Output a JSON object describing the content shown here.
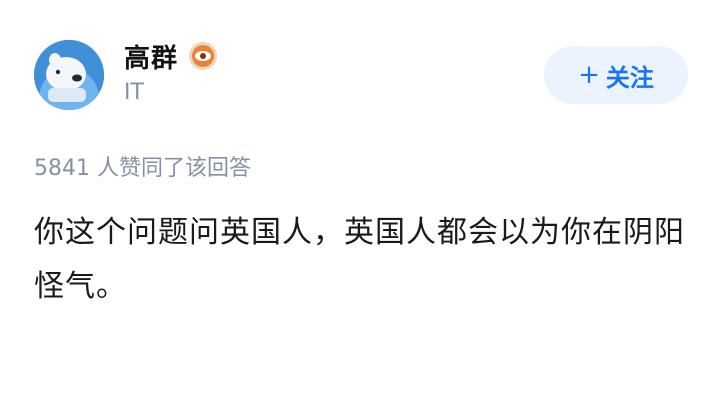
{
  "author": {
    "name": "高群",
    "badge_icon": "eye-badge-icon",
    "tag": "IT"
  },
  "follow_button": {
    "icon": "+",
    "label": "关注"
  },
  "answer": {
    "likes_text": "5841 人赞同了该回答",
    "body": "你这个问题问英国人，英国人都会以为你在阴阳怪气。"
  },
  "colors": {
    "accent": "#1772f6",
    "follow_bg": "#ebf3fe",
    "meta_text": "#8590a6",
    "avatar_bg": "#3f8fd9",
    "badge": "#e8833a"
  }
}
